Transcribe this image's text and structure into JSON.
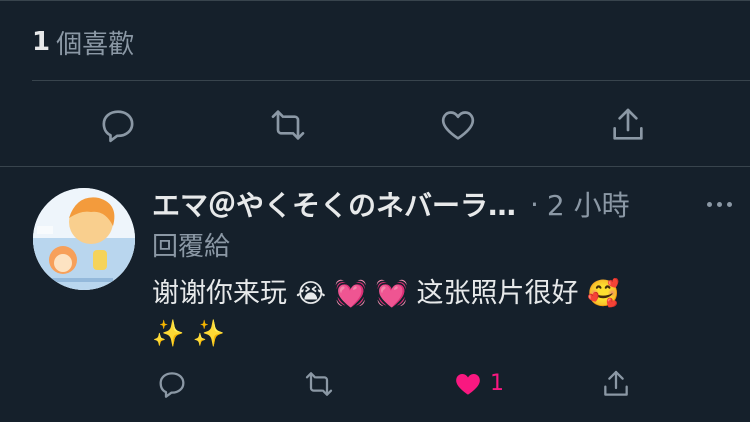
{
  "likes": {
    "count": "1",
    "label": "個喜歡"
  },
  "main_actions": {
    "reply_icon": "reply-icon",
    "retweet_icon": "retweet-icon",
    "like_icon": "heart-outline-icon",
    "share_icon": "share-icon"
  },
  "reply": {
    "display_name": "エマ＠やくそくのネバーラ…",
    "separator": "·",
    "time": "2 小時",
    "replying_label": "回覆給",
    "text_line1": "谢谢你来玩",
    "emoji1": "😭",
    "emoji2": "💓",
    "emoji3": "💓",
    "text_line1b": "这张照片很好",
    "emoji4": "🥰",
    "line2": "✨ ✨",
    "like_count": "1",
    "colors": {
      "liked": "#f91880",
      "muted": "#8b98a5",
      "bg": "#15202b"
    }
  }
}
